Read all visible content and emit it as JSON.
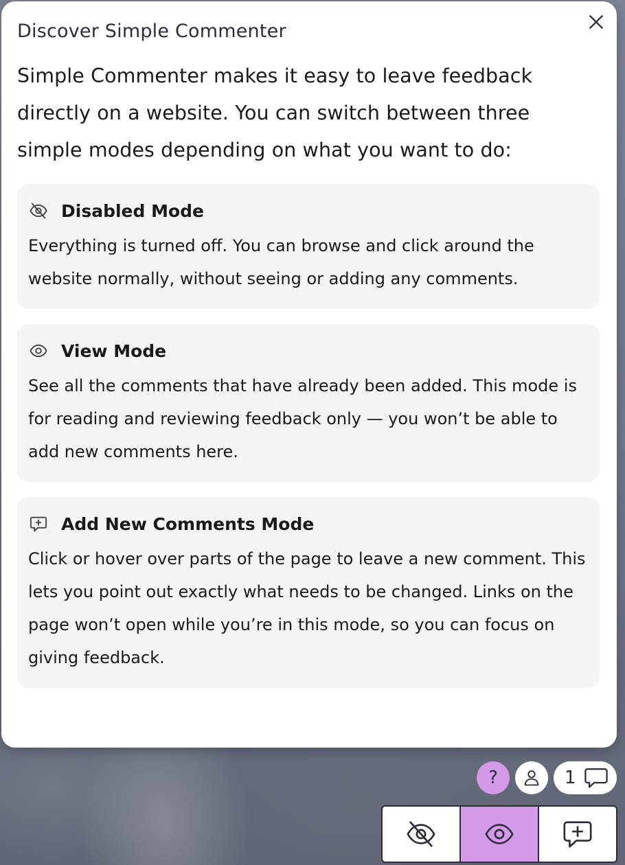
{
  "dialog": {
    "title": "Discover Simple Commenter",
    "close_icon": "close-icon",
    "intro": "Simple Commenter makes it easy to leave feedback directly on a website. You can switch between three simple modes depending on what you want to do:",
    "cards": [
      {
        "icon": "eye-off-icon",
        "title": "Disabled Mode",
        "text": "Everything is turned off. You can browse and click around the website normally, without seeing or adding any comments."
      },
      {
        "icon": "eye-icon",
        "title": "View Mode",
        "text": "See all the comments that have already been added. This mode is for reading and reviewing feedback only — you won’t be able to add new comments here."
      },
      {
        "icon": "comment-plus-icon",
        "title": "Add New Comments Mode",
        "text": "Click or hover over parts of the page to leave a new comment. This lets you point out exactly what needs to be changed. Links on the page won’t open while you’re in this mode, so you can focus on giving feedback."
      }
    ]
  },
  "toolbar": {
    "help_label": "?",
    "comment_count": "1",
    "active_mode": "view",
    "modes": [
      "disabled",
      "view",
      "add"
    ]
  },
  "colors": {
    "accent": "#d49ae8",
    "card_bg": "#f5f5f6",
    "text": "#1a1a1a",
    "border": "#2b2e3a"
  }
}
